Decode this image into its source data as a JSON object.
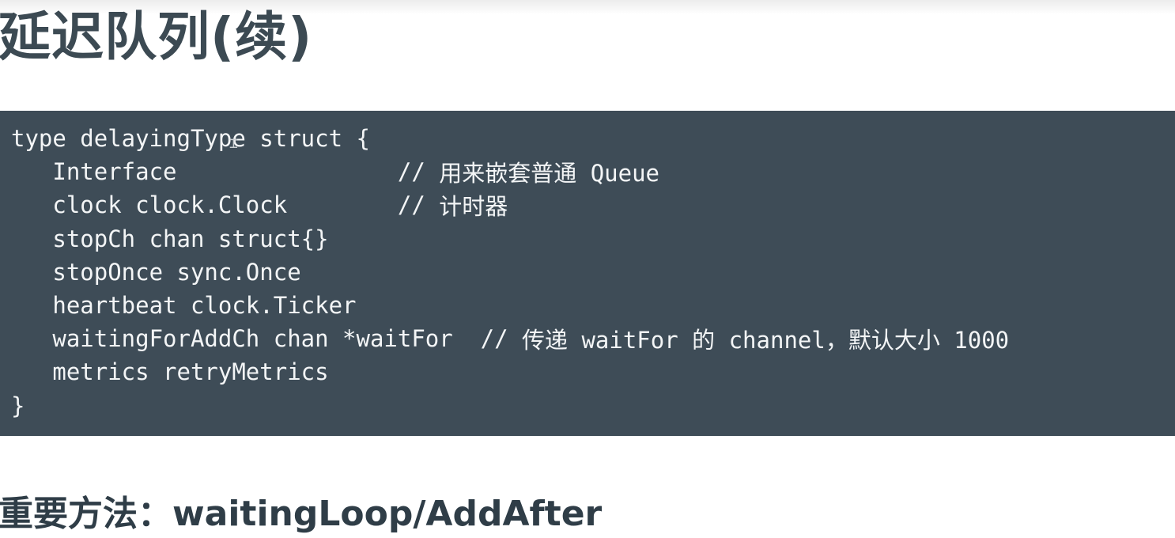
{
  "slide": {
    "title": "延迟队列(续)",
    "subheading": "重要方法：waitingLoop/AddAfter"
  },
  "code": {
    "lines": [
      {
        "text": "type delayingType struct {",
        "comment": ""
      },
      {
        "text": "   Interface                //",
        "comment": " 用来嵌套普通 Queue"
      },
      {
        "text": "   clock clock.Clock        //",
        "comment": " 计时器"
      },
      {
        "text": "   stopCh chan struct{}",
        "comment": ""
      },
      {
        "text": "   stopOnce sync.Once",
        "comment": ""
      },
      {
        "text": "   heartbeat clock.Ticker",
        "comment": ""
      },
      {
        "text": "   waitingForAddCh chan *waitFor  //",
        "comment": " 传递 waitFor 的 channel，默认大小 1000"
      },
      {
        "text": "   metrics retryMetrics",
        "comment": ""
      },
      {
        "text": "}",
        "comment": ""
      }
    ]
  },
  "colors": {
    "title": "#3c4a53",
    "code_background": "#3e4c57",
    "code_text": "#f3f5f6",
    "subheading": "#2f3d47"
  },
  "icons": {
    "cursor": "text-cursor-icon"
  }
}
